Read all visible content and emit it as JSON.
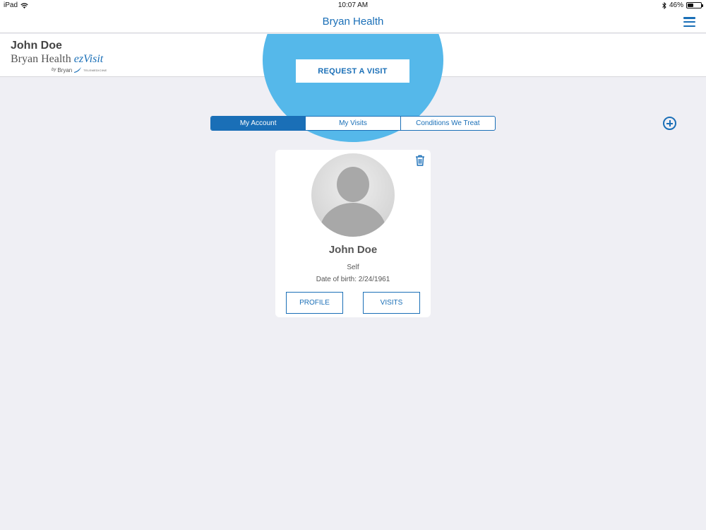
{
  "status_bar": {
    "device": "iPad",
    "time": "10:07 AM",
    "battery_percent": "46%",
    "battery_level": 0.46
  },
  "nav": {
    "title": "Bryan Health",
    "menu_icon": "hamburger-menu-icon"
  },
  "header": {
    "user_name": "John Doe",
    "logo": {
      "brand": "Bryan Health ",
      "product": "ezVisit",
      "by": "by",
      "sub_brand": "Bryan",
      "sub_text": "TELEMEDICINE"
    },
    "request_button": "REQUEST A VISIT"
  },
  "tabs": [
    {
      "label": "My Account",
      "active": true
    },
    {
      "label": "My Visits",
      "active": false
    },
    {
      "label": "Conditions We Treat",
      "active": false
    }
  ],
  "add_icon": "plus-circle-icon",
  "card": {
    "name": "John Doe",
    "relation": "Self",
    "dob": "Date of birth: 2/24/1961",
    "profile_button": "PROFILE",
    "visits_button": "VISITS",
    "trash_icon": "trash-icon"
  },
  "colors": {
    "accent": "#1a6fb7",
    "circle": "#55b8ea",
    "background": "#efeff4"
  }
}
